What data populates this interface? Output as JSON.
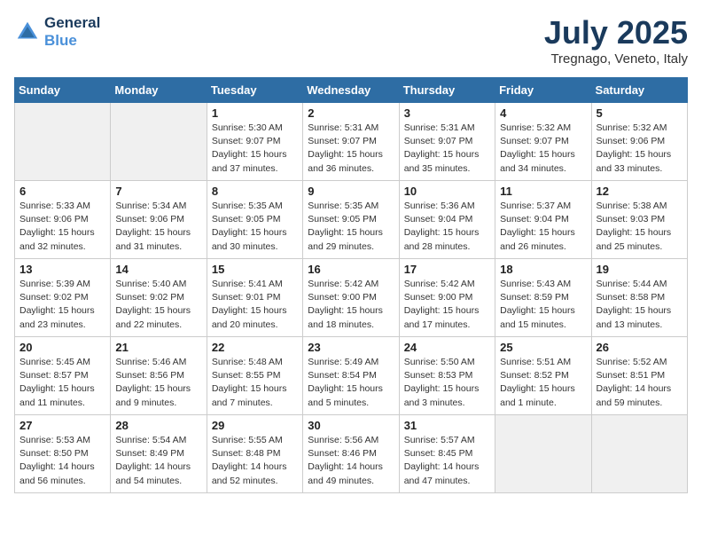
{
  "header": {
    "logo_line1": "General",
    "logo_line2": "Blue",
    "month": "July 2025",
    "location": "Tregnago, Veneto, Italy"
  },
  "days_of_week": [
    "Sunday",
    "Monday",
    "Tuesday",
    "Wednesday",
    "Thursday",
    "Friday",
    "Saturday"
  ],
  "weeks": [
    [
      {
        "day": "",
        "empty": true
      },
      {
        "day": "",
        "empty": true
      },
      {
        "day": "1",
        "sunrise": "5:30 AM",
        "sunset": "9:07 PM",
        "daylight": "15 hours and 37 minutes."
      },
      {
        "day": "2",
        "sunrise": "5:31 AM",
        "sunset": "9:07 PM",
        "daylight": "15 hours and 36 minutes."
      },
      {
        "day": "3",
        "sunrise": "5:31 AM",
        "sunset": "9:07 PM",
        "daylight": "15 hours and 35 minutes."
      },
      {
        "day": "4",
        "sunrise": "5:32 AM",
        "sunset": "9:07 PM",
        "daylight": "15 hours and 34 minutes."
      },
      {
        "day": "5",
        "sunrise": "5:32 AM",
        "sunset": "9:06 PM",
        "daylight": "15 hours and 33 minutes."
      }
    ],
    [
      {
        "day": "6",
        "sunrise": "5:33 AM",
        "sunset": "9:06 PM",
        "daylight": "15 hours and 32 minutes."
      },
      {
        "day": "7",
        "sunrise": "5:34 AM",
        "sunset": "9:06 PM",
        "daylight": "15 hours and 31 minutes."
      },
      {
        "day": "8",
        "sunrise": "5:35 AM",
        "sunset": "9:05 PM",
        "daylight": "15 hours and 30 minutes."
      },
      {
        "day": "9",
        "sunrise": "5:35 AM",
        "sunset": "9:05 PM",
        "daylight": "15 hours and 29 minutes."
      },
      {
        "day": "10",
        "sunrise": "5:36 AM",
        "sunset": "9:04 PM",
        "daylight": "15 hours and 28 minutes."
      },
      {
        "day": "11",
        "sunrise": "5:37 AM",
        "sunset": "9:04 PM",
        "daylight": "15 hours and 26 minutes."
      },
      {
        "day": "12",
        "sunrise": "5:38 AM",
        "sunset": "9:03 PM",
        "daylight": "15 hours and 25 minutes."
      }
    ],
    [
      {
        "day": "13",
        "sunrise": "5:39 AM",
        "sunset": "9:02 PM",
        "daylight": "15 hours and 23 minutes."
      },
      {
        "day": "14",
        "sunrise": "5:40 AM",
        "sunset": "9:02 PM",
        "daylight": "15 hours and 22 minutes."
      },
      {
        "day": "15",
        "sunrise": "5:41 AM",
        "sunset": "9:01 PM",
        "daylight": "15 hours and 20 minutes."
      },
      {
        "day": "16",
        "sunrise": "5:42 AM",
        "sunset": "9:00 PM",
        "daylight": "15 hours and 18 minutes."
      },
      {
        "day": "17",
        "sunrise": "5:42 AM",
        "sunset": "9:00 PM",
        "daylight": "15 hours and 17 minutes."
      },
      {
        "day": "18",
        "sunrise": "5:43 AM",
        "sunset": "8:59 PM",
        "daylight": "15 hours and 15 minutes."
      },
      {
        "day": "19",
        "sunrise": "5:44 AM",
        "sunset": "8:58 PM",
        "daylight": "15 hours and 13 minutes."
      }
    ],
    [
      {
        "day": "20",
        "sunrise": "5:45 AM",
        "sunset": "8:57 PM",
        "daylight": "15 hours and 11 minutes."
      },
      {
        "day": "21",
        "sunrise": "5:46 AM",
        "sunset": "8:56 PM",
        "daylight": "15 hours and 9 minutes."
      },
      {
        "day": "22",
        "sunrise": "5:48 AM",
        "sunset": "8:55 PM",
        "daylight": "15 hours and 7 minutes."
      },
      {
        "day": "23",
        "sunrise": "5:49 AM",
        "sunset": "8:54 PM",
        "daylight": "15 hours and 5 minutes."
      },
      {
        "day": "24",
        "sunrise": "5:50 AM",
        "sunset": "8:53 PM",
        "daylight": "15 hours and 3 minutes."
      },
      {
        "day": "25",
        "sunrise": "5:51 AM",
        "sunset": "8:52 PM",
        "daylight": "15 hours and 1 minute."
      },
      {
        "day": "26",
        "sunrise": "5:52 AM",
        "sunset": "8:51 PM",
        "daylight": "14 hours and 59 minutes."
      }
    ],
    [
      {
        "day": "27",
        "sunrise": "5:53 AM",
        "sunset": "8:50 PM",
        "daylight": "14 hours and 56 minutes."
      },
      {
        "day": "28",
        "sunrise": "5:54 AM",
        "sunset": "8:49 PM",
        "daylight": "14 hours and 54 minutes."
      },
      {
        "day": "29",
        "sunrise": "5:55 AM",
        "sunset": "8:48 PM",
        "daylight": "14 hours and 52 minutes."
      },
      {
        "day": "30",
        "sunrise": "5:56 AM",
        "sunset": "8:46 PM",
        "daylight": "14 hours and 49 minutes."
      },
      {
        "day": "31",
        "sunrise": "5:57 AM",
        "sunset": "8:45 PM",
        "daylight": "14 hours and 47 minutes."
      },
      {
        "day": "",
        "empty": true
      },
      {
        "day": "",
        "empty": true
      }
    ]
  ]
}
